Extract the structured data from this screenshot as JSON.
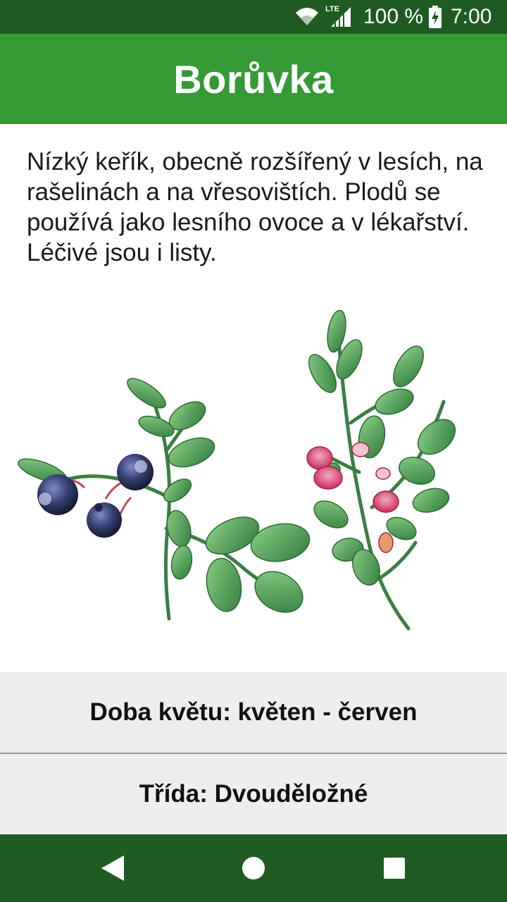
{
  "status_bar": {
    "network_label": "LTE",
    "battery_percent": "100 %",
    "time": "7:00",
    "icons": [
      "wifi-icon",
      "signal-icon",
      "battery-charging-icon"
    ],
    "background": "#1e5b20"
  },
  "app_bar": {
    "title": "Borůvka",
    "background": "#359a35"
  },
  "content": {
    "description": "Nízký keřík, obecně rozšířený v lesích, na rašelinách a na vřesovištích. Plodů se používá jako lesního ovoce a v lékařství. Léčivé jsou i listy.",
    "image": "blueberry-plant-illustration",
    "bloom_time": "Doba květu: květen - červen",
    "plant_class": "Třída: Dvouděložné"
  },
  "nav_bar": {
    "buttons": [
      "back-icon",
      "home-icon",
      "recents-icon"
    ],
    "background": "#1e5b20"
  },
  "colors": {
    "berry": "#2f3768",
    "leaf": "#4f9a55",
    "flower": "#d8406a",
    "row_background": "#eeeeee"
  }
}
